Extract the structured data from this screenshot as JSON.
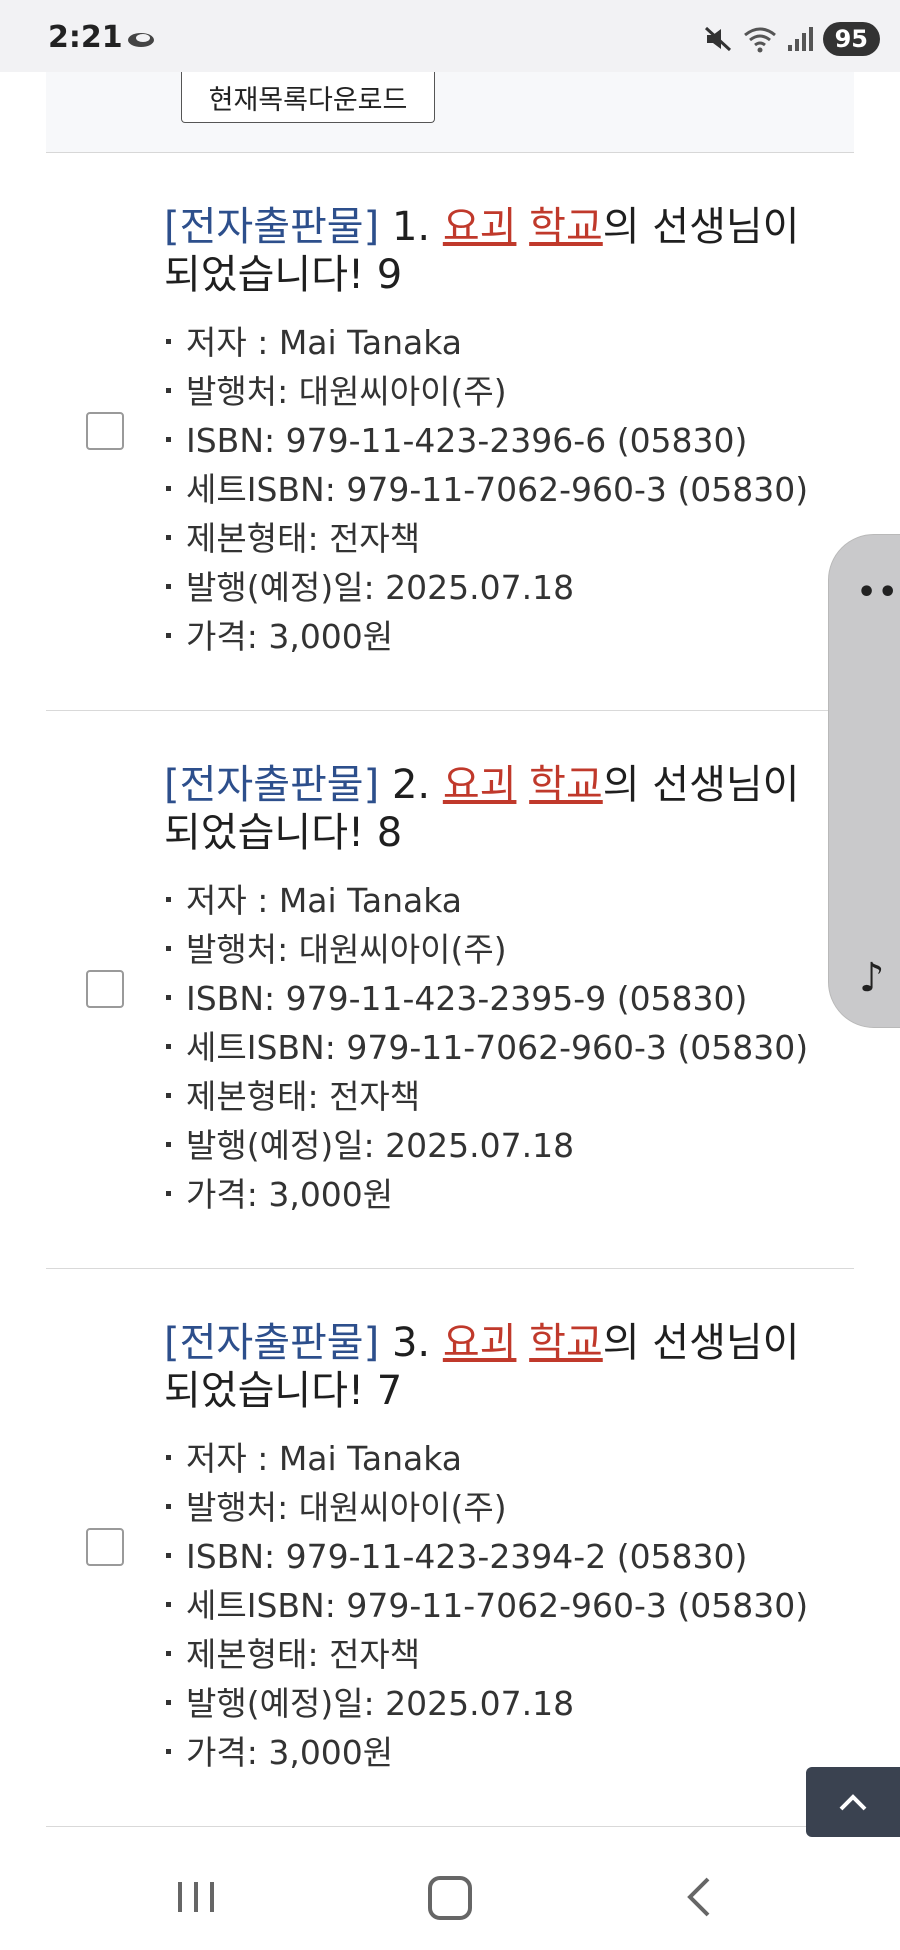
{
  "status_bar": {
    "time": "2:21",
    "battery": "95",
    "icons": [
      "cloud-icon",
      "mute-icon",
      "wifi-icon",
      "signal-icon"
    ]
  },
  "toolbar": {
    "download_label": "현재목록다운로드"
  },
  "labels": {
    "author": "저자 : ",
    "publisher": "발행처: ",
    "isbn": "ISBN: ",
    "set_isbn": "세트ISBN: ",
    "format": "제본형태: ",
    "pub_date": "발행(예정)일: ",
    "price": "가격: "
  },
  "results": [
    {
      "category": "[전자출판물]",
      "number": "1.",
      "kw1": "요괴",
      "kw2": "학교",
      "title_rest": "의 선생님이 되었습니다! 9",
      "author": "Mai Tanaka",
      "publisher": "대원씨아이(주)",
      "isbn": "979-11-423-2396-6 (05830)",
      "set_isbn": "979-11-7062-960-3 (05830)",
      "format": "전자책",
      "pub_date": "2025.07.18",
      "price": "3,000원"
    },
    {
      "category": "[전자출판물]",
      "number": "2.",
      "kw1": "요괴",
      "kw2": "학교",
      "title_rest": "의 선생님이 되었습니다! 8",
      "author": "Mai Tanaka",
      "publisher": "대원씨아이(주)",
      "isbn": "979-11-423-2395-9 (05830)",
      "set_isbn": "979-11-7062-960-3 (05830)",
      "format": "전자책",
      "pub_date": "2025.07.18",
      "price": "3,000원"
    },
    {
      "category": "[전자출판물]",
      "number": "3.",
      "kw1": "요괴",
      "kw2": "학교",
      "title_rest": "의 선생님이 되었습니다! 7",
      "author": "Mai Tanaka",
      "publisher": "대원씨아이(주)",
      "isbn": "979-11-423-2394-2 (05830)",
      "set_isbn": "979-11-7062-960-3 (05830)",
      "format": "전자책",
      "pub_date": "2025.07.18",
      "price": "3,000원"
    }
  ],
  "side_panel": {
    "more_label": "•••",
    "music_icon": "music-note-icon"
  },
  "colors": {
    "category": "#2d4f8c",
    "keyword": "#c0392b",
    "to_top_bg": "#3a4250"
  }
}
